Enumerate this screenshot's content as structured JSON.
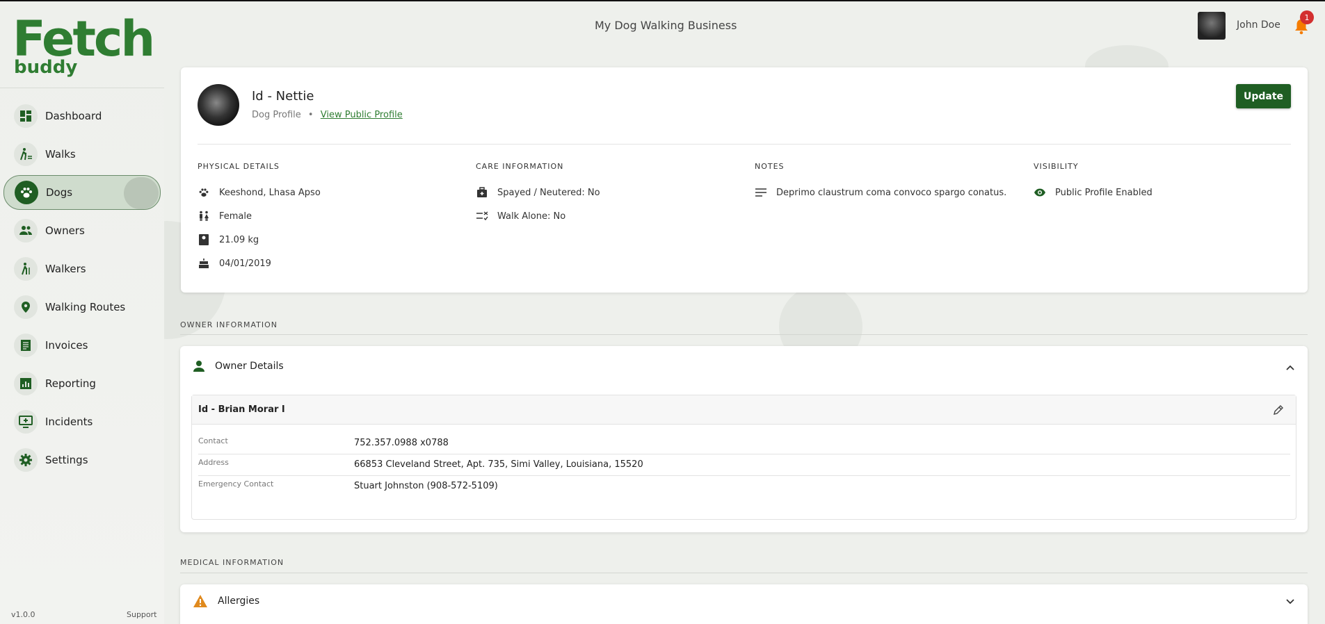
{
  "app": {
    "title": "My Dog Walking Business"
  },
  "logo": {
    "word1": "Fetch",
    "word2": "buddy"
  },
  "user": {
    "name": "John Doe",
    "notification_count": "1"
  },
  "sidebar": {
    "items": [
      {
        "label": "Dashboard",
        "icon": "dashboard-icon"
      },
      {
        "label": "Walks",
        "icon": "walk-icon"
      },
      {
        "label": "Dogs",
        "icon": "paw-icon",
        "active": true
      },
      {
        "label": "Owners",
        "icon": "people-icon"
      },
      {
        "label": "Walkers",
        "icon": "hiker-icon"
      },
      {
        "label": "Walking Routes",
        "icon": "location-pin-icon"
      },
      {
        "label": "Invoices",
        "icon": "invoice-icon"
      },
      {
        "label": "Reporting",
        "icon": "chart-icon"
      },
      {
        "label": "Incidents",
        "icon": "incident-icon"
      },
      {
        "label": "Settings",
        "icon": "gear-icon"
      }
    ],
    "version": "v1.0.0",
    "support": "Support"
  },
  "profile": {
    "name": "Id - Nettie",
    "subtitle": "Dog Profile",
    "separator": "•",
    "public_link": "View Public Profile",
    "update_label": "Update",
    "physical": {
      "heading": "PHYSICAL DETAILS",
      "breed": "Keeshond, Lhasa Apso",
      "sex": "Female",
      "weight": "21.09 kg",
      "dob": "04/01/2019"
    },
    "care": {
      "heading": "CARE INFORMATION",
      "spayed": "Spayed / Neutered: No",
      "walk_alone": "Walk Alone: No"
    },
    "notes": {
      "heading": "NOTES",
      "text": "Deprimo claustrum coma convoco spargo conatus."
    },
    "visibility": {
      "heading": "VISIBILITY",
      "text": "Public Profile Enabled"
    }
  },
  "owner": {
    "section_heading": "OWNER INFORMATION",
    "accordion_title": "Owner Details",
    "name": "Id - Brian Morar I",
    "fields": [
      {
        "key": "Contact",
        "value": "752.357.0988 x0788"
      },
      {
        "key": "Address",
        "value": "66853 Cleveland Street, Apt. 735, Simi Valley, Louisiana, 15520"
      },
      {
        "key": "Emergency Contact",
        "value": "Stuart Johnston (908-572-5109)"
      }
    ]
  },
  "medical": {
    "section_heading": "MEDICAL INFORMATION",
    "accordion_title": "Allergies"
  },
  "colors": {
    "brand": "#1f5e23",
    "accent": "#2f7d32",
    "warning": "#e08a1e",
    "badge": "#d32f2f"
  }
}
